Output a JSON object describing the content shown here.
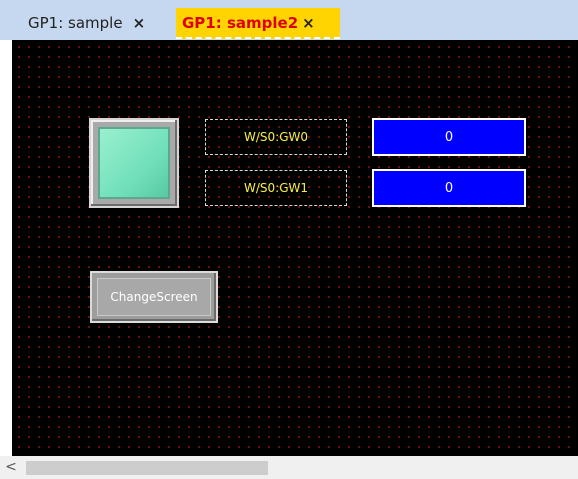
{
  "tabs": [
    {
      "label": "GP1: sample",
      "close": "×",
      "active": false
    },
    {
      "label": "GP1: sample2",
      "close": "×",
      "active": true
    }
  ],
  "screen": {
    "lamp": {
      "color": "#7fe8c5"
    },
    "address_tags": [
      {
        "label": "W/S0:GW0"
      },
      {
        "label": "W/S0:GW1"
      }
    ],
    "numeric_displays": [
      {
        "value": "0"
      },
      {
        "value": "0"
      }
    ],
    "button": {
      "label": "ChangeScreen"
    }
  },
  "colors": {
    "canvas_background": "#000000",
    "grid_dot": "#7a1010",
    "tag_text": "#f3f04a",
    "numeric_background": "#0000ff",
    "active_tab_background": "#ffd400",
    "active_tab_text": "#e00000"
  },
  "scrollbar": {
    "left_arrow_icon": "chevron-left-icon",
    "glyph": "<"
  }
}
